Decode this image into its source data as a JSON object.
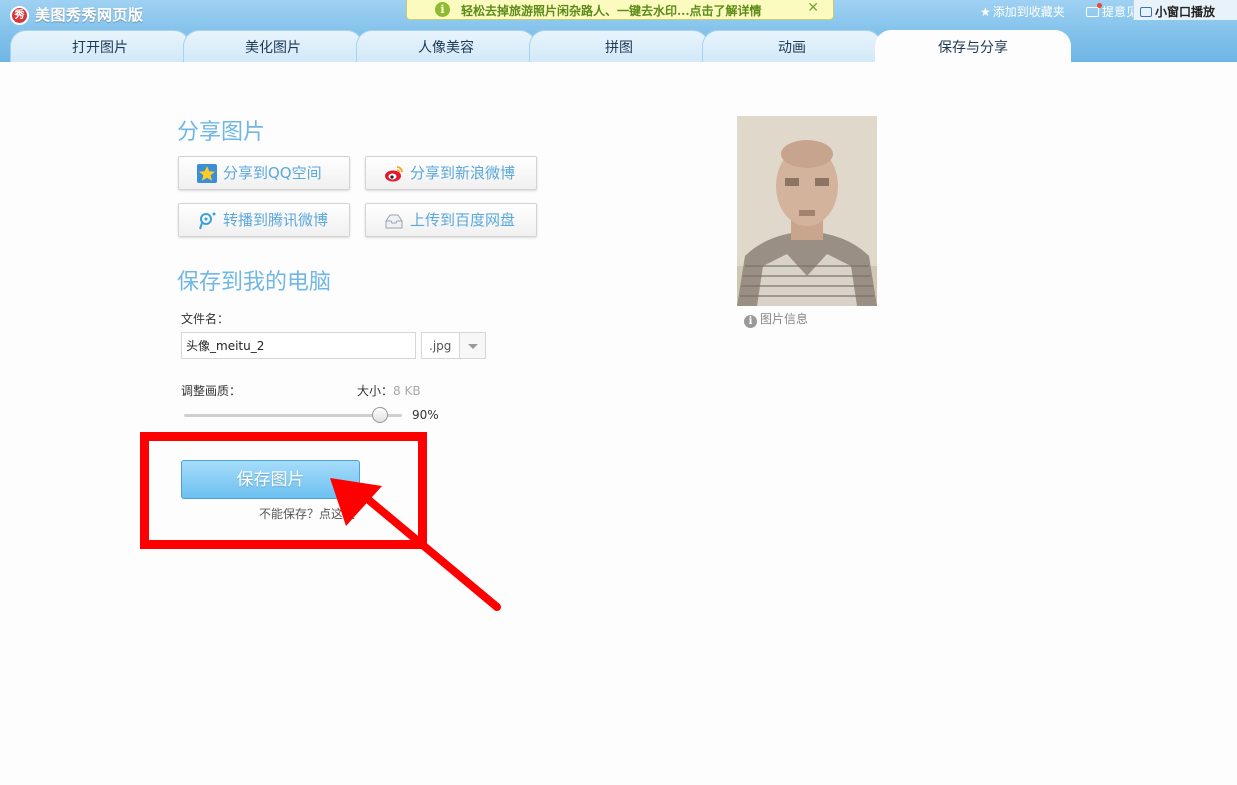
{
  "app": {
    "logo_text": "秀",
    "title": "美图秀秀网页版"
  },
  "notice": {
    "icon": "info-icon",
    "text": "轻松去掉旅游照片闲杂路人、一键去水印...点击了解详情",
    "close": "✕"
  },
  "header_links": {
    "favorite": "添加到收藏夹",
    "feedback": "提意见",
    "mini_window": "小窗口播放"
  },
  "tabs": [
    {
      "label": "打开图片"
    },
    {
      "label": "美化图片"
    },
    {
      "label": "人像美容"
    },
    {
      "label": "拼图"
    },
    {
      "label": "动画"
    },
    {
      "label": "保存与分享",
      "active": true
    }
  ],
  "share": {
    "title": "分享图片",
    "buttons": [
      {
        "label": "分享到QQ空间",
        "icon": "qzone-star-icon"
      },
      {
        "label": "分享到新浪微博",
        "icon": "weibo-icon"
      },
      {
        "label": "转播到腾讯微博",
        "icon": "tencent-weibo-icon"
      },
      {
        "label": "上传到百度网盘",
        "icon": "cloud-disk-icon"
      }
    ]
  },
  "save": {
    "title": "保存到我的电脑",
    "filename_label": "文件名：",
    "filename_value": "头像_meitu_2",
    "extension": ".jpg",
    "quality_label": "调整画质：",
    "size_label": "大小：",
    "size_value": "8 KB",
    "quality_percent": "90%",
    "quality_value": 0.9,
    "save_button": "保存图片",
    "cant_save": "不能保存？点这里"
  },
  "preview": {
    "info_label": "图片信息"
  },
  "colors": {
    "accent": "#6fb8e6",
    "header": "#7fc0ea",
    "annotation": "#ff0000"
  }
}
